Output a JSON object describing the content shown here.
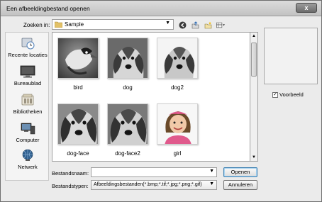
{
  "window": {
    "title": "Een afbeeldingbestand openen",
    "close_glyph": "x"
  },
  "lookin": {
    "label": "Zoeken in:",
    "value": "Sample"
  },
  "places": [
    {
      "label": "Recente locaties",
      "icon": "recent-locations-icon"
    },
    {
      "label": "Bureaublad",
      "icon": "desktop-icon"
    },
    {
      "label": "Bibliotheken",
      "icon": "libraries-icon"
    },
    {
      "label": "Computer",
      "icon": "computer-icon"
    },
    {
      "label": "Netwerk",
      "icon": "network-icon"
    }
  ],
  "files": [
    {
      "name": "bird",
      "kind": "bird"
    },
    {
      "name": "dog",
      "kind": "dog"
    },
    {
      "name": "dog2",
      "kind": "dog"
    },
    {
      "name": "dog-face",
      "kind": "dog"
    },
    {
      "name": "dog-face2",
      "kind": "dog"
    },
    {
      "name": "girl",
      "kind": "girl"
    }
  ],
  "preview": {
    "label": "Voorbeeld",
    "checked": true
  },
  "filename": {
    "label": "Bestandsnaam:",
    "value": ""
  },
  "filetype": {
    "label": "Bestandstypen:",
    "value": "Afbeeldingsbestanden(*.bmp;*.tif;*.jpg;*.png;*.gif)"
  },
  "buttons": {
    "open": "Openen",
    "cancel": "Annuleren"
  }
}
